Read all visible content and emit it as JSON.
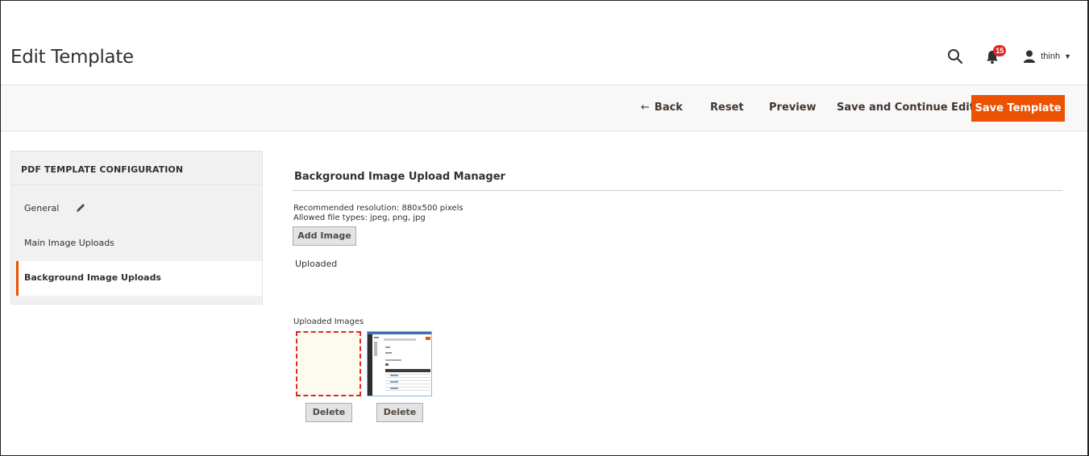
{
  "header": {
    "title": "Edit Template",
    "notifications_count": "15",
    "user_name": "thinh"
  },
  "actions": {
    "back": "Back",
    "reset": "Reset",
    "preview": "Preview",
    "save_continue": "Save and Continue Edit",
    "save_template": "Save Template"
  },
  "sidebar": {
    "title": "PDF TEMPLATE CONFIGURATION",
    "items": [
      {
        "label": "General"
      },
      {
        "label": "Main Image Uploads"
      },
      {
        "label": "Background Image Uploads"
      }
    ]
  },
  "main": {
    "section_title": "Background Image Upload Manager",
    "recommended": "Recommended resolution: 880x500 pixels",
    "allowed": "Allowed file types: jpeg, png, jpg",
    "add_image": "Add Image",
    "uploaded_label": "Uploaded",
    "uploaded_images_label": "Uploaded Images",
    "delete_label": "Delete"
  },
  "colors": {
    "accent": "#eb5202",
    "badge": "#e22626"
  }
}
